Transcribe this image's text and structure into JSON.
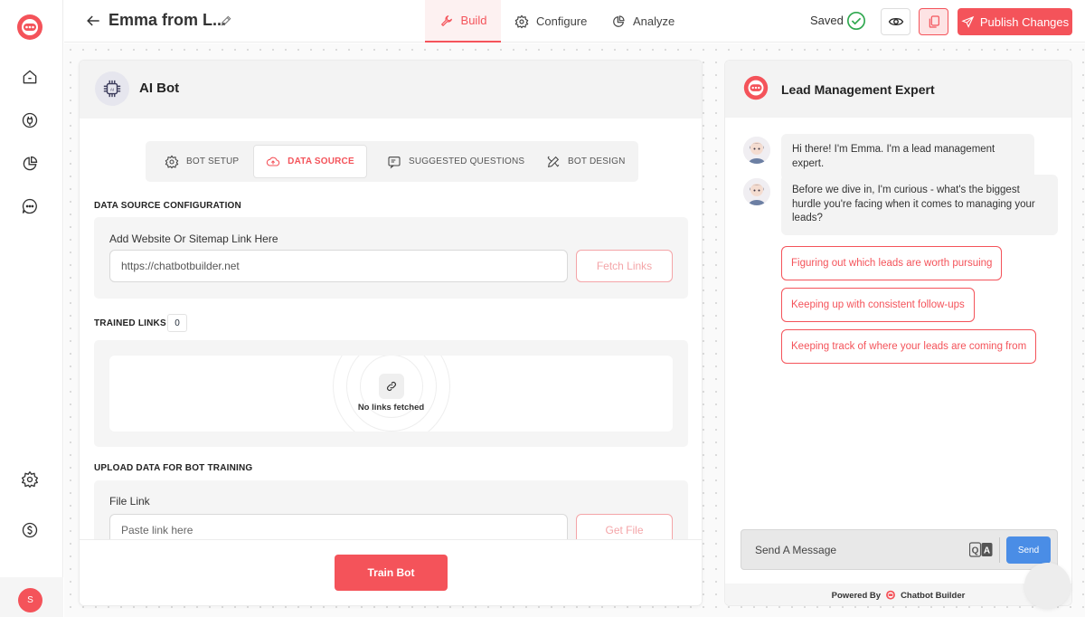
{
  "topbar": {
    "bot_name": "Emma from L...",
    "tabs": [
      {
        "label": "Build",
        "icon": "wrench-icon"
      },
      {
        "label": "Configure",
        "icon": "gear-icon"
      },
      {
        "label": "Analyze",
        "icon": "pie-chart-icon"
      }
    ],
    "saved_label": "Saved",
    "publish_label": "Publish Changes"
  },
  "sidebar": {
    "items": [
      {
        "icon": "home-icon"
      },
      {
        "icon": "plug-icon"
      },
      {
        "icon": "analytics-icon"
      },
      {
        "icon": "chat-icon"
      }
    ],
    "bottom_items": [
      {
        "icon": "settings-icon"
      },
      {
        "icon": "billing-icon"
      }
    ],
    "avatar_initial": "S"
  },
  "builder": {
    "title": "AI Bot",
    "subtabs": [
      {
        "label": "BOT SETUP"
      },
      {
        "label": "DATA SOURCE"
      },
      {
        "label": "SUGGESTED QUESTIONS"
      },
      {
        "label": "BOT DESIGN"
      }
    ],
    "data_source": {
      "section_title": "DATA SOURCE CONFIGURATION",
      "field_label": "Add Website Or Sitemap Link Here",
      "url_value": "https://chatbotbuilder.net",
      "fetch_label": "Fetch Links"
    },
    "trained": {
      "section_title": "TRAINED LINKS",
      "count": "0",
      "empty_text": "No links fetched"
    },
    "upload": {
      "section_title": "UPLOAD DATA FOR BOT TRAINING",
      "field_label": "File Link",
      "placeholder": "Paste link here",
      "get_file_label": "Get File"
    },
    "train_label": "Train Bot"
  },
  "preview": {
    "title": "Lead Management Expert",
    "messages": [
      "Hi there! I'm Emma. I'm a lead management expert.",
      "Before we dive in, I'm curious - what's the biggest hurdle you're facing when it comes to managing your leads?"
    ],
    "options": [
      "Figuring out which leads are worth pursuing",
      "Keeping up with consistent follow-ups",
      "Keeping track of where your leads are coming from"
    ],
    "composer_placeholder": "Send A Message",
    "send_label": "Send",
    "powered_prefix": "Powered By",
    "powered_brand": "Chatbot Builder"
  },
  "colors": {
    "accent": "#f4535a",
    "send": "#4a8de6",
    "success": "#2fa84f"
  }
}
